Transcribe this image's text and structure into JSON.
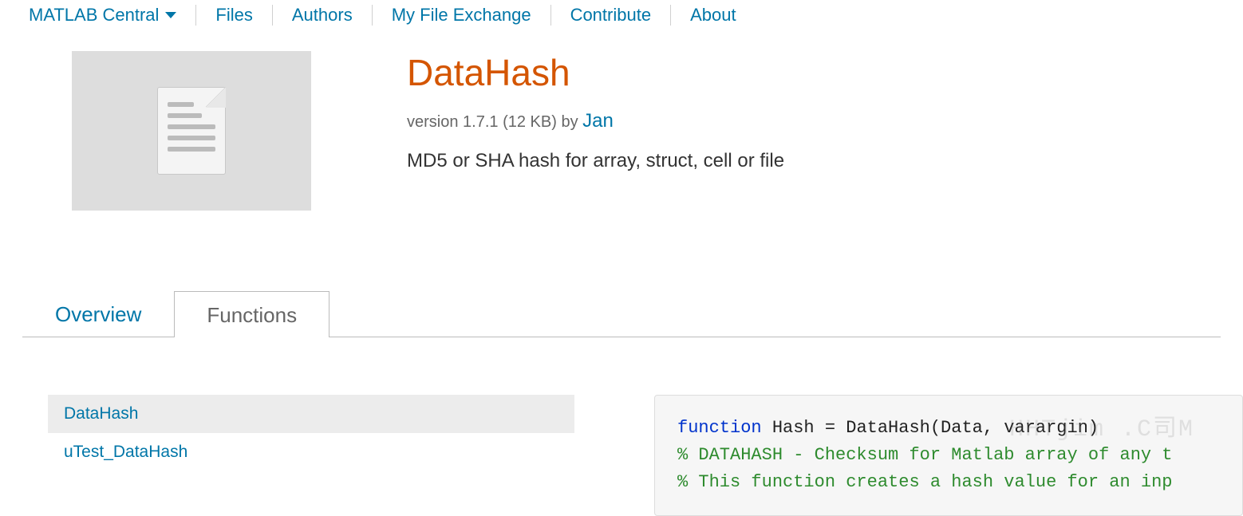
{
  "topnav": {
    "central": "MATLAB Central",
    "items": [
      "Files",
      "Authors",
      "My File Exchange",
      "Contribute",
      "About"
    ]
  },
  "page": {
    "title": "DataHash",
    "version_prefix": "version ",
    "version": "1.7.1",
    "size": "(12 KB)",
    "by": "by",
    "author": "Jan",
    "description": "MD5 or SHA hash for array, struct, cell or file"
  },
  "tabs": {
    "overview": "Overview",
    "functions": "Functions"
  },
  "functions": {
    "items": [
      "DataHash",
      "uTest_DataHash"
    ]
  },
  "code": {
    "kw": "function",
    "sig": " Hash = DataHash(Data, varargin)",
    "c1": "% DATAHASH - Checksum for Matlab array of any t",
    "c2": "% This function creates a hash value for an inp"
  },
  "watermark": "HHTjim .C司M"
}
